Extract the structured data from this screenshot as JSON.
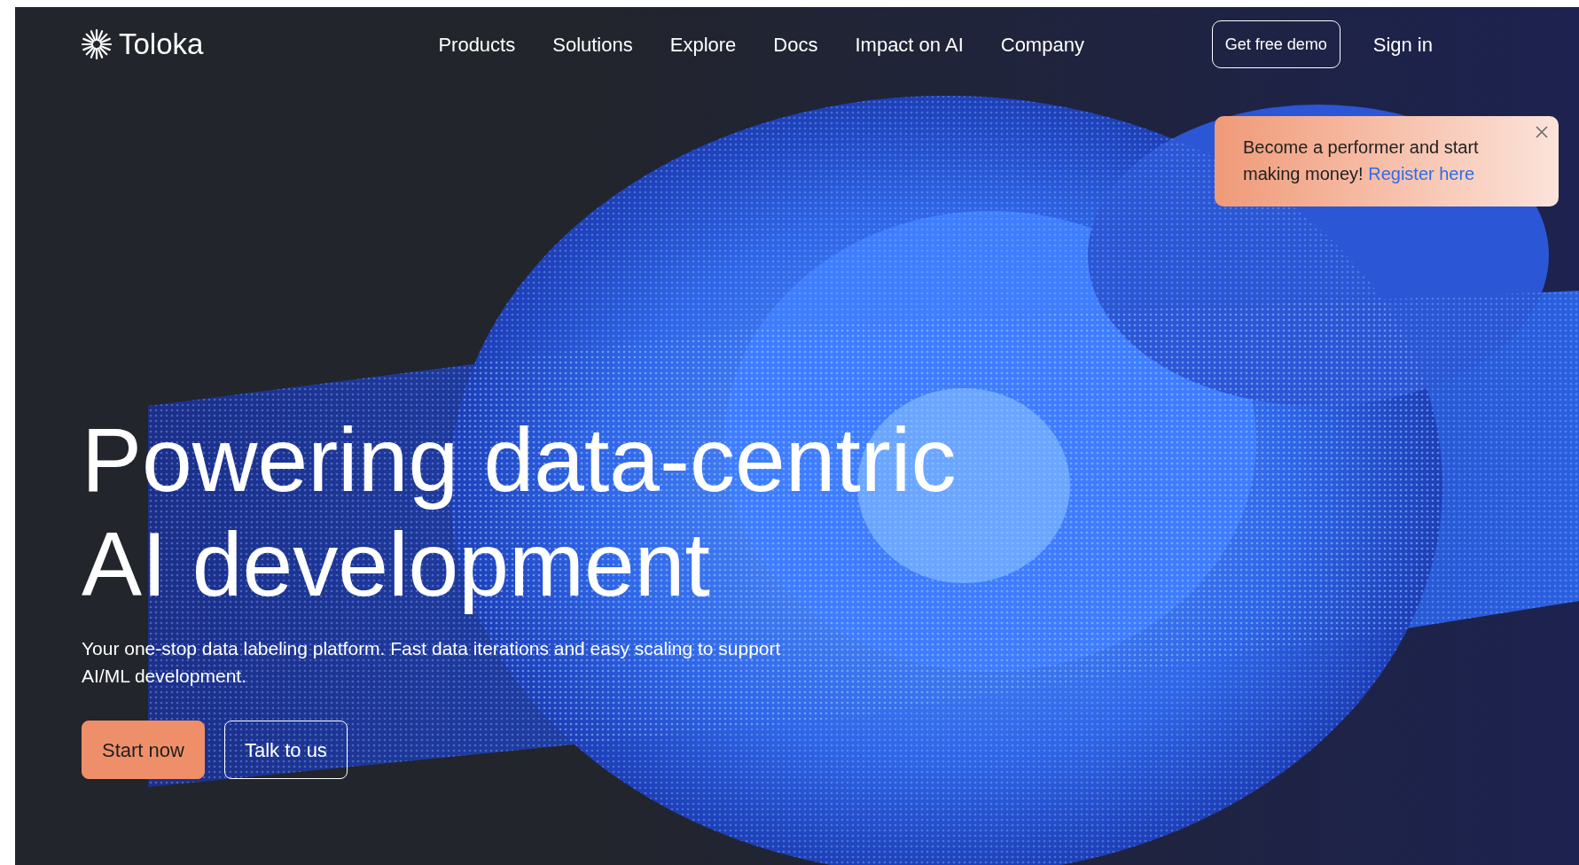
{
  "header": {
    "logo": "Toloka",
    "links": [
      "Products",
      "Solutions",
      "Explore",
      "Docs",
      "Impact on AI",
      "Company"
    ],
    "actions": [
      {
        "label": "Get free demo",
        "kind": "outline"
      },
      {
        "label": "Sign in",
        "kind": "text"
      }
    ]
  },
  "toast": {
    "message": "Become a performer and start making money!",
    "link": "Register here"
  },
  "hero": {
    "title_lines": [
      "Powering data-centric",
      "AI development"
    ],
    "subtitle": "Your one-stop data labeling platform. Fast data iterations and easy scaling to support AI/ML development.",
    "buttons": [
      {
        "label": "Start now",
        "kind": "primary"
      },
      {
        "label": "Talk to us",
        "kind": "outline"
      }
    ]
  }
}
